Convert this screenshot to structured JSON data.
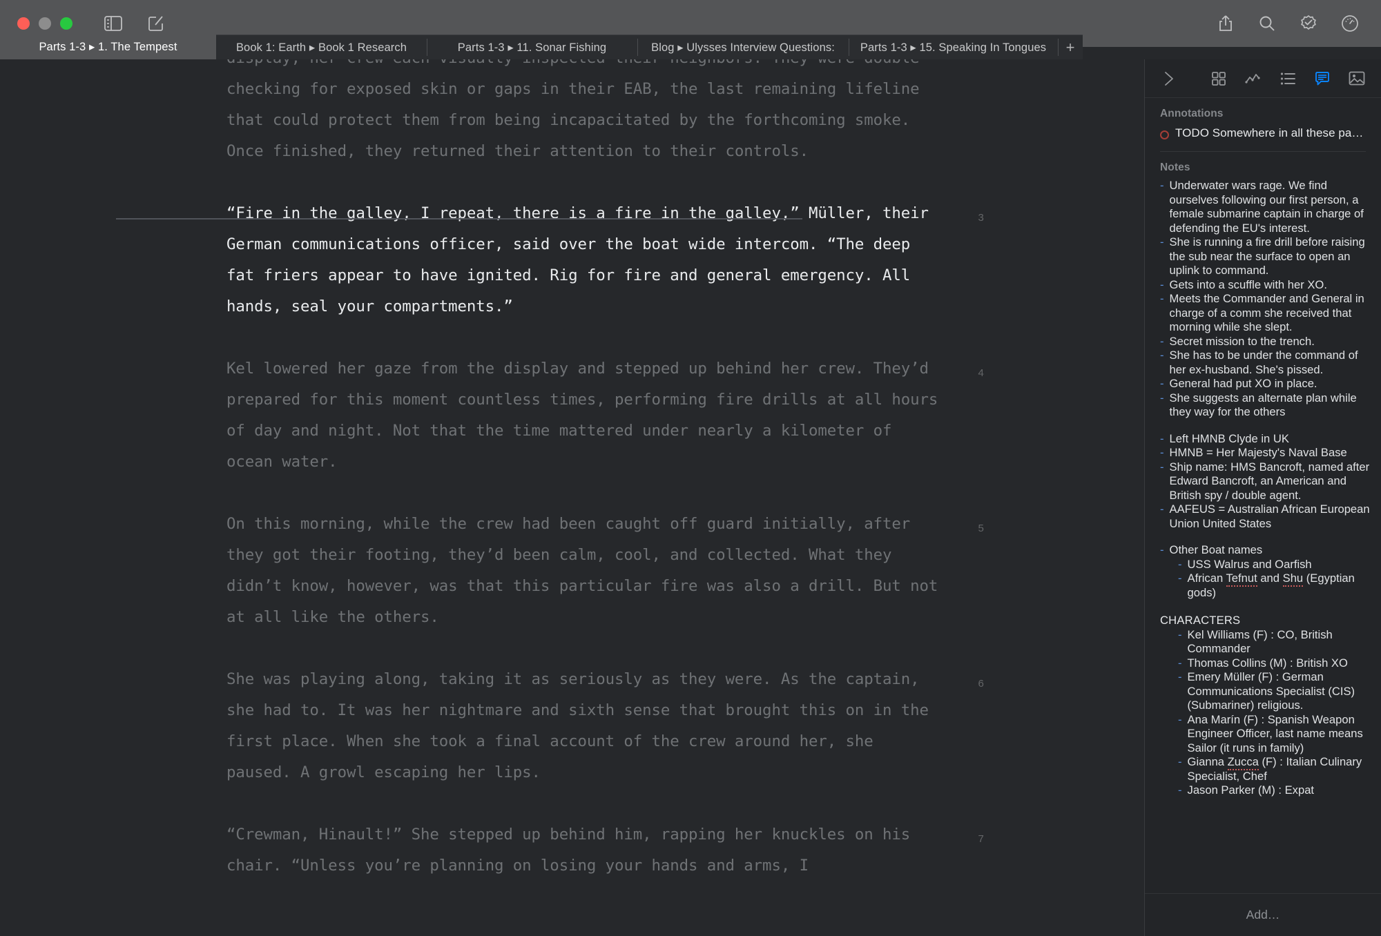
{
  "window": {
    "title": "Parts 1-3 ▸ 1. The Tempest",
    "traffic_lights": [
      "close",
      "minimize",
      "zoom"
    ]
  },
  "toolbar": {
    "left_icons": [
      {
        "name": "sidebar-toggle-icon",
        "label": "Toggle Sidebar"
      },
      {
        "name": "new-sheet-icon",
        "label": "New Sheet"
      }
    ],
    "right_icons": [
      {
        "name": "share-icon",
        "label": "Share"
      },
      {
        "name": "search-icon",
        "label": "Search"
      },
      {
        "name": "proofread-icon",
        "label": "Proofread"
      },
      {
        "name": "dashboard-icon",
        "label": "Statistics"
      }
    ]
  },
  "tabs": {
    "items": [
      {
        "label": "Parts 1-3 ▸ 1. The Tempest",
        "active": true
      },
      {
        "label": "Book 1: Earth ▸ Book 1 Research",
        "active": false
      },
      {
        "label": "Parts 1-3 ▸ 11. Sonar Fishing",
        "active": false
      },
      {
        "label": "Blog ▸ Ulysses Interview Questions:",
        "active": false
      },
      {
        "label": "Parts 1-3 ▸ 15. Speaking In Tongues",
        "active": false
      }
    ],
    "new_tab_label": "+"
  },
  "editor": {
    "paragraphs": [
      {
        "number": "",
        "focus": false,
        "text": "display, her crew each visually inspected their neighbors. They were double-checking for exposed skin or gaps in their EAB, the last remaining lifeline that could protect them from being incapacitated by the forthcoming smoke. Once finished, they returned their attention to their controls."
      },
      {
        "number": "3",
        "focus": true,
        "text": "“Fire in the galley, I repeat, there is a fire in the galley,” Müller, their German communications officer, said over the boat wide intercom. “The deep fat friers appear to have ignited. Rig for fire and general emergency. All hands, seal your compartments.”"
      },
      {
        "number": "4",
        "focus": false,
        "text": "Kel lowered her gaze from the display and stepped up behind her crew. They’d prepared for this moment countless times, performing fire drills at all hours of day and night. Not that the time mattered under nearly a kilometer of ocean water."
      },
      {
        "number": "5",
        "focus": false,
        "text": "On this morning, while the crew had been caught off guard initially, after they got their footing, they’d been calm, cool, and collected. What they didn’t know, however, was that this particular fire was also a drill. But not at all like the others."
      },
      {
        "number": "6",
        "focus": false,
        "text": "She was playing along, taking it as seriously as they were. As the captain, she had to. It was her nightmare and sixth sense that brought this on in the first place. When she took a final account of the crew around her, she paused. A growl escaping her lips."
      },
      {
        "number": "7",
        "focus": false,
        "text": "“Crewman, Hinault!” She stepped up behind him, rapping her knuckles on his chair. “Unless you’re planning on losing your hands and arms, I"
      }
    ]
  },
  "sidebar": {
    "toolbar_icons": [
      {
        "name": "collapse-chevron-icon",
        "label": "Collapse",
        "active": false
      },
      {
        "name": "grid-icon",
        "label": "Keywords",
        "active": false
      },
      {
        "name": "goal-chart-icon",
        "label": "Goal",
        "active": false
      },
      {
        "name": "list-icon",
        "label": "Outline",
        "active": false
      },
      {
        "name": "notes-comment-icon",
        "label": "Notes",
        "active": true
      },
      {
        "name": "image-icon",
        "label": "Images",
        "active": false
      }
    ],
    "annotations": {
      "title": "Annotations",
      "items": [
        {
          "text": "TODO Somewhere in all these pa…",
          "color": "#a43e37"
        }
      ]
    },
    "notes": {
      "title": "Notes",
      "groups": [
        {
          "lines": [
            {
              "indent": 0,
              "text": "Underwater wars rage. We find ourselves following our first person, a female submarine captain in charge of defending the EU's interest."
            },
            {
              "indent": 0,
              "text": "She is running a fire drill before raising the sub near the surface to open an uplink to command."
            },
            {
              "indent": 0,
              "text": "Gets into a scuffle with her XO."
            },
            {
              "indent": 0,
              "text": "Meets the Commander and General in charge of a comm she received that morning while she slept."
            },
            {
              "indent": 0,
              "text": "Secret mission to the trench."
            },
            {
              "indent": 0,
              "text": "She has to be under the command of her ex-husband. She's pissed."
            },
            {
              "indent": 0,
              "text": "General had put XO in place."
            },
            {
              "indent": 0,
              "text": "She suggests an alternate plan while they way for the others"
            }
          ]
        },
        {
          "lines": [
            {
              "indent": 0,
              "text": "Left HMNB Clyde in UK"
            },
            {
              "indent": 0,
              "text": "HMNB = Her Majesty's Naval Base"
            },
            {
              "indent": 0,
              "text": "Ship name: HMS Bancroft, named after Edward Bancroft, an American and British spy / double agent."
            },
            {
              "indent": 0,
              "text": "AAFEUS = Australian African European Union United States"
            }
          ]
        },
        {
          "lines": [
            {
              "indent": 0,
              "text": "Other Boat names"
            },
            {
              "indent": 1,
              "text": "USS Walrus and Oarfish"
            },
            {
              "indent": 1,
              "text": "African Tefnut and Shu (Egyptian gods)",
              "misspelled": [
                "Tefnut",
                "Shu"
              ]
            }
          ]
        }
      ],
      "characters_heading": "CHARACTERS",
      "characters": [
        {
          "indent": 1,
          "text": "Kel Williams (F) : CO, British Commander"
        },
        {
          "indent": 1,
          "text": "Thomas Collins (M) : British XO"
        },
        {
          "indent": 1,
          "text": "Emery Müller (F) : German Communications Specialist (CIS) (Submariner) religious."
        },
        {
          "indent": 1,
          "text": "Ana Marín (F) : Spanish Weapon Engineer Officer, last name means Sailor (it runs in family)"
        },
        {
          "indent": 1,
          "text": "Gianna Zucca (F) : Italian Culinary Specialist, Chef",
          "misspelled": [
            "Zucca"
          ]
        },
        {
          "indent": 1,
          "text": "Jason Parker (M) : Expat"
        }
      ]
    },
    "add_label": "Add…"
  },
  "colors": {
    "titlebar": "#545557",
    "tab_inactive": "#2b2d30",
    "editor_bg": "#26282b",
    "sidebar_bg": "#232528",
    "accent_blue": "#0a84ff",
    "bullet_blue": "#5b8dd6",
    "annotation_red": "#a43e37",
    "focus_text": "#e9ebed",
    "dim_text": "#6f7275"
  }
}
